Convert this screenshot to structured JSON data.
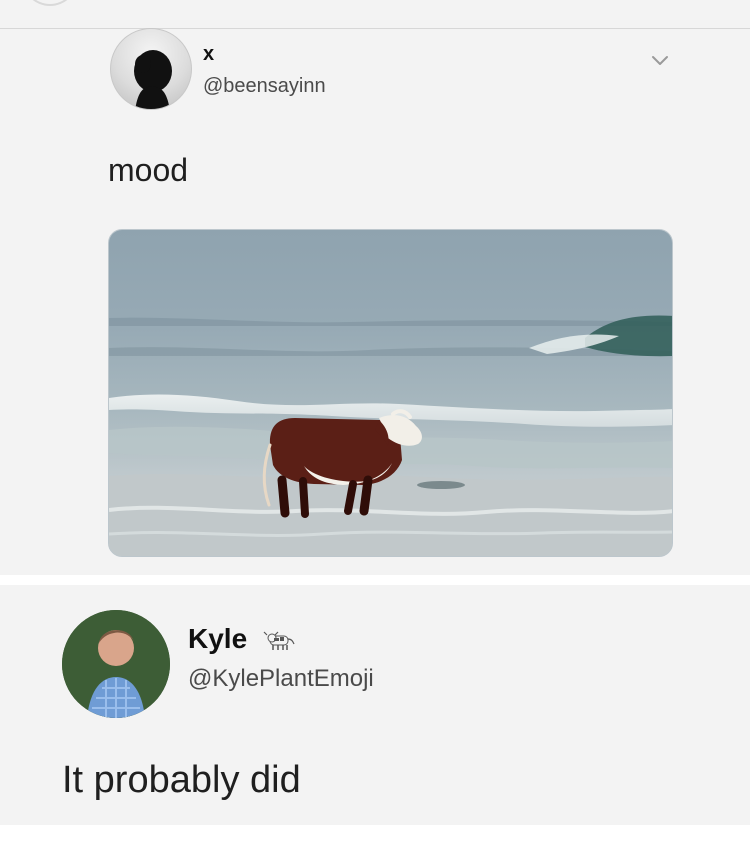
{
  "first_tweet": {
    "name": "x",
    "handle": "@beensayinn",
    "text": "mood",
    "avatar": "silhouette-avatar",
    "menu_icon": "chevron-down-icon",
    "media": "cow-standing-in-ocean-photo"
  },
  "reply_tweet": {
    "name": "Kyle",
    "name_emoji": "cow-emoji",
    "handle": "@KylePlantEmoji",
    "text": "It probably did",
    "avatar": "profile-photo"
  }
}
